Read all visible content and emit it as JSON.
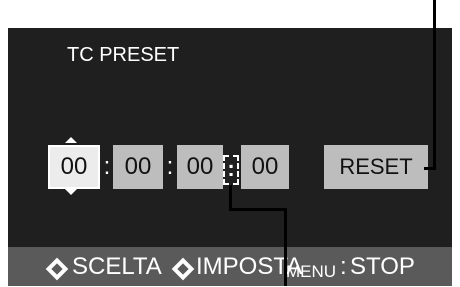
{
  "title": "TC PRESET",
  "timecode": {
    "hours": "00",
    "minutes": "00",
    "seconds": "00",
    "frames": "00",
    "sep_1": ":",
    "sep_2": ":",
    "sep_3": ":",
    "frame_sep": ":"
  },
  "reset_label": "RESET",
  "footer": {
    "select_label": "SCELTA",
    "set_label": "IMPOSTA",
    "menu_label": "MENU",
    "menu_colon": ":",
    "stop_label": "STOP"
  },
  "colors": {
    "screen_background": "#1f1f1f",
    "field_background": "#bdbdbd",
    "selected_field": "#ececec",
    "footer_background": "#5a5a5a"
  }
}
